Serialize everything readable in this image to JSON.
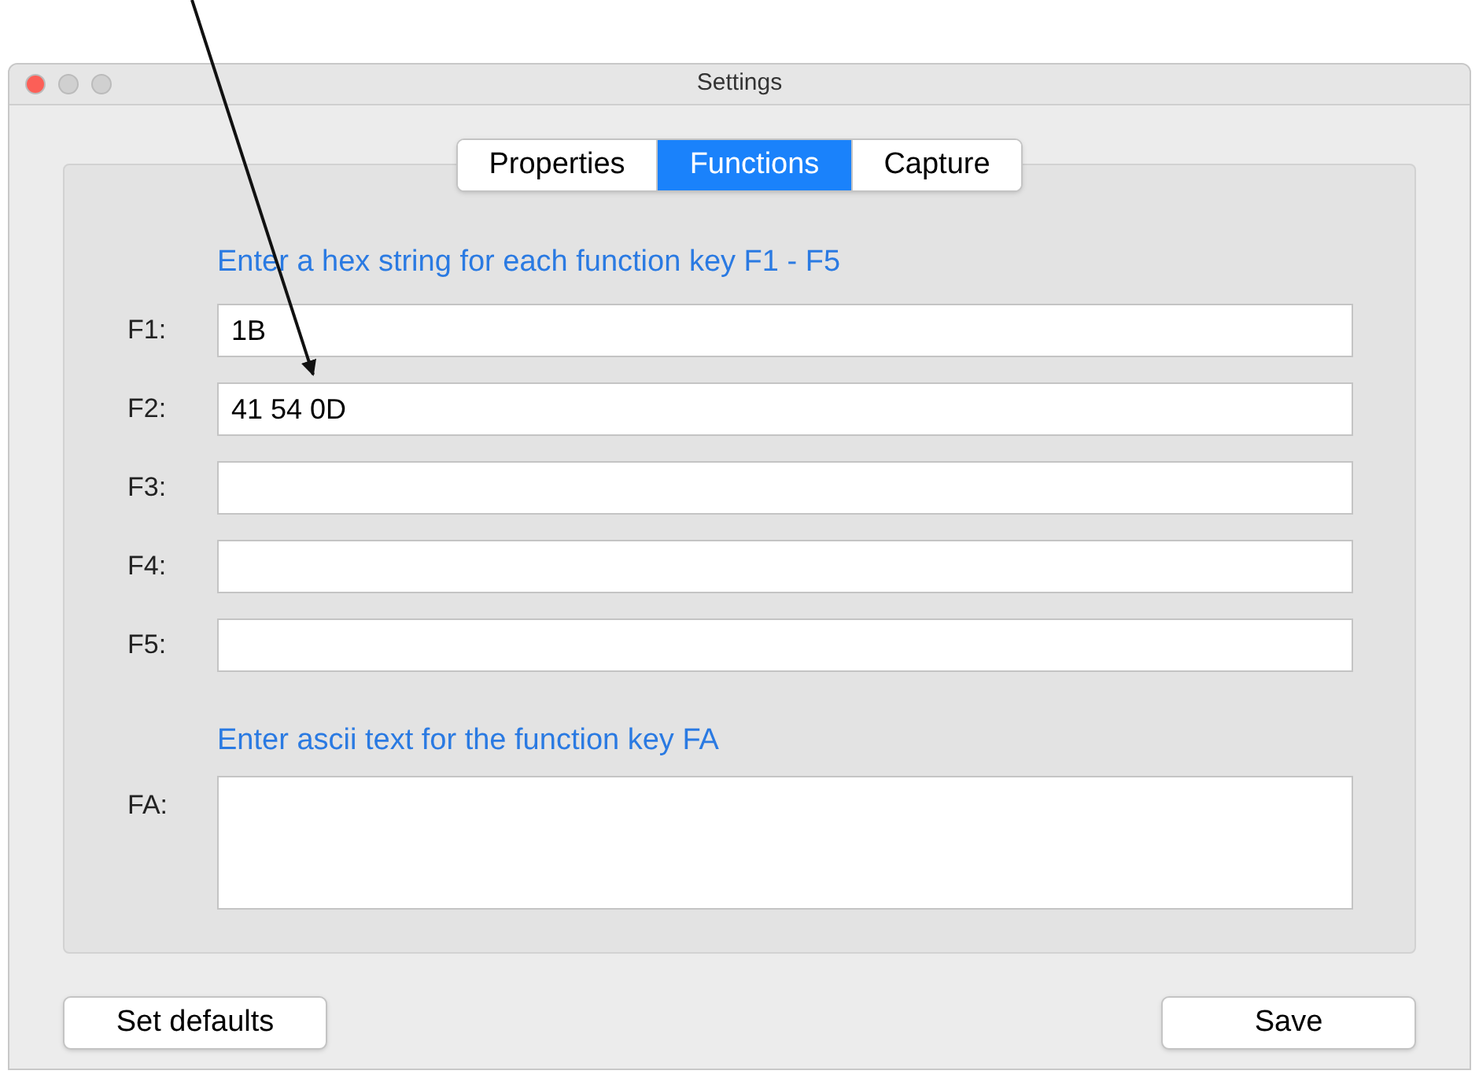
{
  "window": {
    "title": "Settings"
  },
  "tabs": [
    {
      "label": "Properties",
      "selected": false
    },
    {
      "label": "Functions",
      "selected": true
    },
    {
      "label": "Capture",
      "selected": false
    }
  ],
  "hex_section": {
    "heading": "Enter a hex string for each function key F1 - F5",
    "fields": [
      {
        "label": "F1:",
        "value": "1B"
      },
      {
        "label": "F2:",
        "value": "41 54 0D"
      },
      {
        "label": "F3:"
      },
      {
        "label": "F4:"
      },
      {
        "label": "F5:"
      }
    ]
  },
  "ascii_section": {
    "heading": "Enter ascii text for the function key FA",
    "field": {
      "label": "FA:"
    }
  },
  "buttons": {
    "left": "Set defaults",
    "right": "Save"
  }
}
